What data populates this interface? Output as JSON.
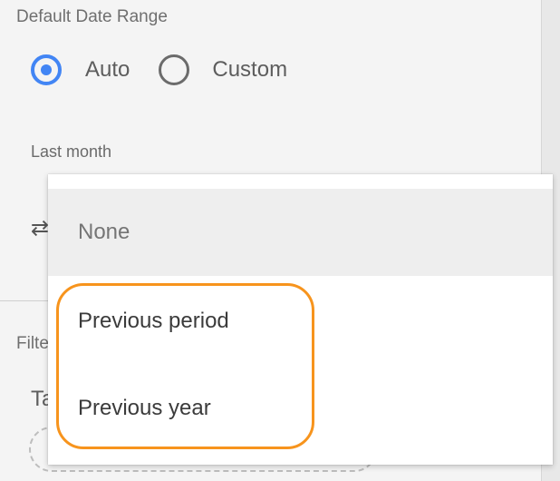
{
  "date_range": {
    "section_label": "Default Date Range",
    "options": [
      {
        "label": "Auto",
        "selected": true
      },
      {
        "label": "Custom",
        "selected": false
      }
    ],
    "current_value": "Last month"
  },
  "comparison": {
    "icon": "compare-arrows-icon",
    "dropdown_options": [
      "None",
      "Previous period",
      "Previous year"
    ],
    "hovered_option": "None"
  },
  "filter": {
    "section_label": "Filte",
    "table_label": "Ta"
  },
  "colors": {
    "accent": "#4285f4",
    "highlight": "#f7941d"
  }
}
